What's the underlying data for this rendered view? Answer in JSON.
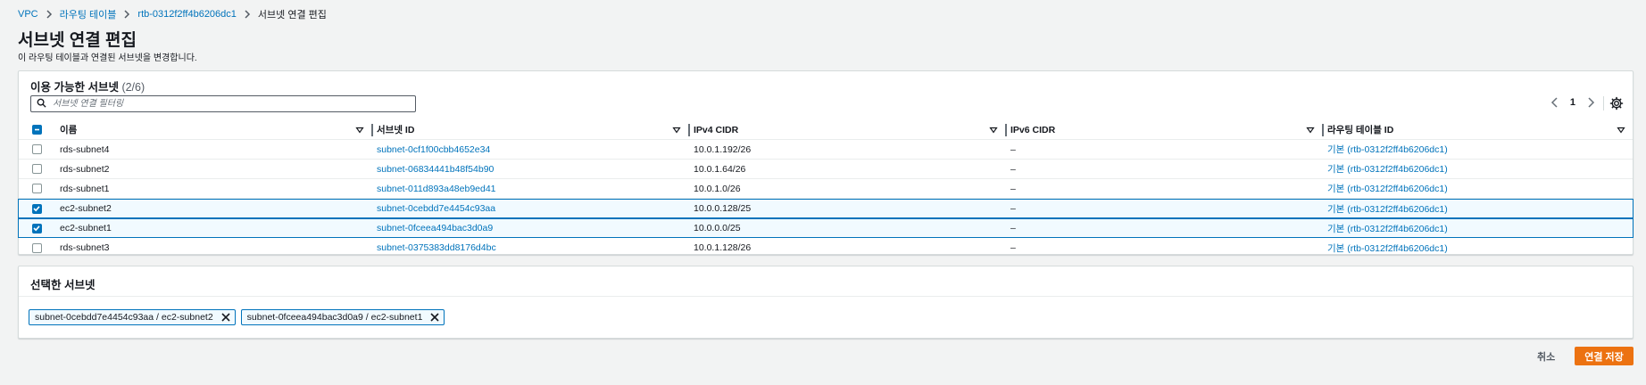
{
  "breadcrumb": {
    "items": [
      "VPC",
      "라우팅 테이블",
      "rtb-0312f2ff4b6206dc1"
    ],
    "current": "서브넷 연결 편집"
  },
  "page": {
    "title": "서브넷 연결 편집",
    "description": "이 라우팅 테이블과 연결된 서브넷을 변경합니다."
  },
  "available": {
    "title": "이용 가능한 서브넷",
    "count": "(2/6)",
    "filter_placeholder": "서브넷 연결 필터링",
    "page_number": "1",
    "columns": [
      "이름",
      "서브넷 ID",
      "IPv4 CIDR",
      "IPv6 CIDR",
      "라우팅 테이블 ID"
    ],
    "rows": [
      {
        "name": "rds-subnet4",
        "id": "subnet-0cf1f00cbb4652e34",
        "ipv4": "10.0.1.192/26",
        "ipv6": "–",
        "rt": "기본 (rtb-0312f2ff4b6206dc1)",
        "checked": false
      },
      {
        "name": "rds-subnet2",
        "id": "subnet-06834441b48f54b90",
        "ipv4": "10.0.1.64/26",
        "ipv6": "–",
        "rt": "기본 (rtb-0312f2ff4b6206dc1)",
        "checked": false
      },
      {
        "name": "rds-subnet1",
        "id": "subnet-011d893a48eb9ed41",
        "ipv4": "10.0.1.0/26",
        "ipv6": "–",
        "rt": "기본 (rtb-0312f2ff4b6206dc1)",
        "checked": false
      },
      {
        "name": "ec2-subnet2",
        "id": "subnet-0cebdd7e4454c93aa",
        "ipv4": "10.0.0.128/25",
        "ipv6": "–",
        "rt": "기본 (rtb-0312f2ff4b6206dc1)",
        "checked": true
      },
      {
        "name": "ec2-subnet1",
        "id": "subnet-0fceea494bac3d0a9",
        "ipv4": "10.0.0.0/25",
        "ipv6": "–",
        "rt": "기본 (rtb-0312f2ff4b6206dc1)",
        "checked": true
      },
      {
        "name": "rds-subnet3",
        "id": "subnet-0375383dd8176d4bc",
        "ipv4": "10.0.1.128/26",
        "ipv6": "–",
        "rt": "기본 (rtb-0312f2ff4b6206dc1)",
        "checked": false
      }
    ]
  },
  "selected": {
    "title": "선택한 서브넷",
    "tokens": [
      "subnet-0cebdd7e4454c93aa / ec2-subnet2",
      "subnet-0fceea494bac3d0a9 / ec2-subnet1"
    ]
  },
  "footer": {
    "cancel_label": "취소",
    "save_label": "연결 저장"
  },
  "colors": {
    "link": "#0073bb",
    "primary_button": "#ec7211",
    "selected_row_bg": "#f1faff"
  }
}
